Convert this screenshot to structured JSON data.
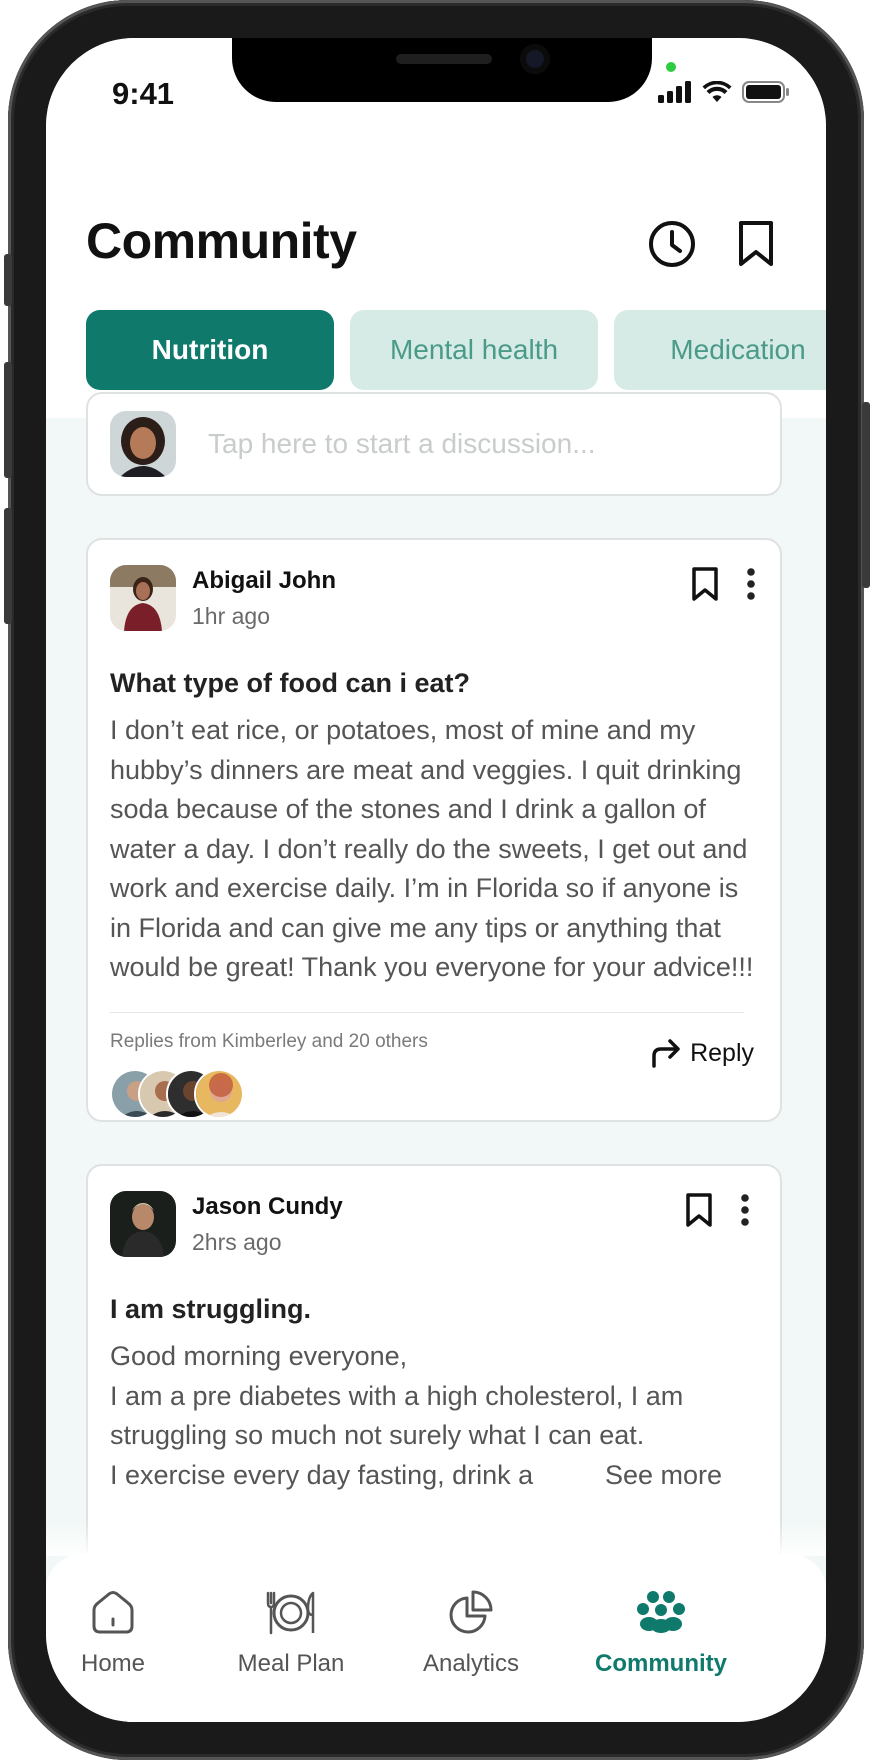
{
  "status_bar": {
    "time": "9:41"
  },
  "header": {
    "title": "Community",
    "history_icon": "clock-icon",
    "bookmarks_icon": "bookmark-icon"
  },
  "tabs": [
    {
      "label": "Nutrition",
      "active": true
    },
    {
      "label": "Mental health",
      "active": false
    },
    {
      "label": "Medication",
      "active": false
    }
  ],
  "composer": {
    "placeholder": "Tap here to start a discussion..."
  },
  "posts": [
    {
      "author": "Abigail John",
      "time": "1hr ago",
      "title": "What type of food can i eat?",
      "body": "I don’t eat rice, or potatoes, most of mine and my hubby’s dinners are meat and veggies. I quit drinking soda because of the stones and I drink a gallon of water a day. I don’t really do the sweets, I get out and work and exercise daily. I’m in Florida so if anyone is in Florida and can give me any tips or anything that would be great! Thank you everyone for your advice!!!",
      "replies_text": "Replies from Kimberley and 20 others",
      "reply_label": "Reply"
    },
    {
      "author": "Jason Cundy",
      "time": "2hrs ago",
      "title": "I am struggling.",
      "body_lines": [
        "Good morning everyone,",
        "I am a pre diabetes with a high cholesterol, I am struggling so much not surely what I can eat.",
        "I exercise every day fasting, drink a"
      ],
      "see_more": "See more"
    }
  ],
  "bottom_nav": [
    {
      "label": "Home",
      "icon": "home-icon",
      "active": false
    },
    {
      "label": "Meal Plan",
      "icon": "plate-utensils-icon",
      "active": false
    },
    {
      "label": "Analytics",
      "icon": "pie-chart-icon",
      "active": false
    },
    {
      "label": "Community",
      "icon": "paw-group-icon",
      "active": true
    }
  ],
  "colors": {
    "accent": "#0f7a6c",
    "tab_inactive_bg": "#d6ebe6",
    "tab_inactive_text": "#4a9a8a",
    "screen_bg": "#f2f8f7"
  }
}
